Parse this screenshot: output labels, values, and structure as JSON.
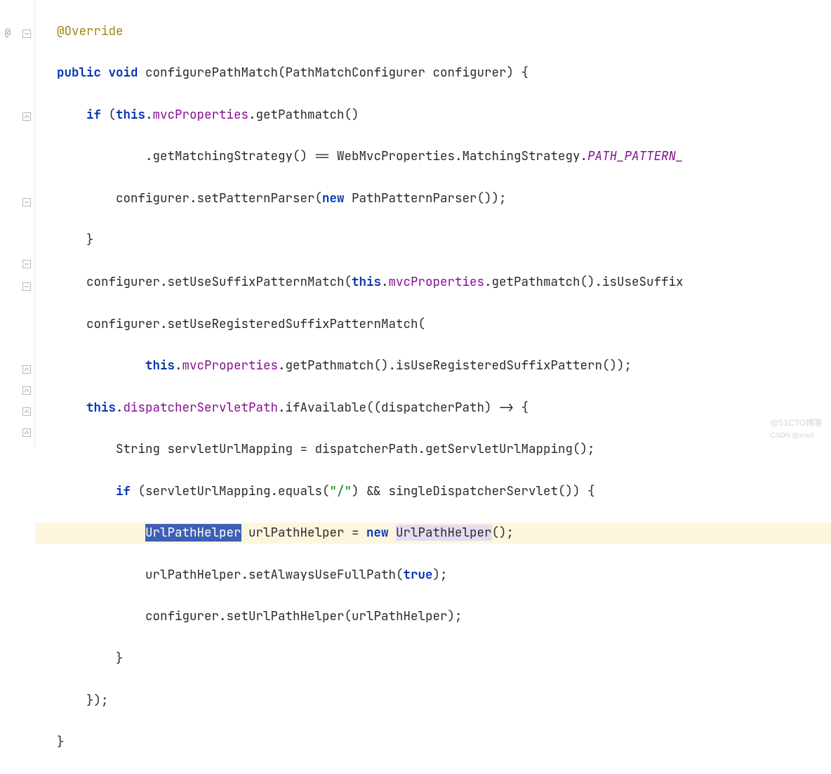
{
  "gutter": {
    "at_symbol": "@"
  },
  "watermark": {
    "text1": "@51CTO博客",
    "text2": "CSDN @zoeil"
  },
  "code": {
    "l1": {
      "ann": "@Override"
    },
    "l2": {
      "kw1": "public",
      "kw2": "void",
      "method": " configurePathMatch(PathMatchConfigurer configurer) {"
    },
    "l3": {
      "kw": "if",
      "t1": " (",
      "kw2": "this",
      "t2": ".",
      "f": "mvcProperties",
      "t3": ".getPathmatch()"
    },
    "l4": {
      "t1": ".getMatchingStrategy() == WebMvcProperties.MatchingStrategy.",
      "sf": "PATH_PATTERN_"
    },
    "l5": {
      "t1": "configurer.setPatternParser(",
      "kw": "new",
      "t2": " PathPatternParser());"
    },
    "l6": {
      "t": "}"
    },
    "l7": {
      "t1": "configurer.setUseSuffixPatternMatch(",
      "kw": "this",
      "t2": ".",
      "f": "mvcProperties",
      "t3": ".getPathmatch().isUseSuffix"
    },
    "l8": {
      "t": "configurer.setUseRegisteredSuffixPatternMatch("
    },
    "l9": {
      "kw": "this",
      "t1": ".",
      "f": "mvcProperties",
      "t2": ".getPathmatch().isUseRegisteredSuffixPattern());"
    },
    "l10": {
      "kw": "this",
      "t1": ".",
      "f": "dispatcherServletPath",
      "t2": ".ifAvailable((dispatcherPath) -> {"
    },
    "l11": {
      "t": "String servletUrlMapping = dispatcherPath.getServletUrlMapping();"
    },
    "l12": {
      "kw": "if",
      "t1": " (servletUrlMapping.equals(",
      "str": "\"/\"",
      "t2": ") && singleDispatcherServlet()) {"
    },
    "l13": {
      "sel": "UrlPathHelper",
      "t1": " urlPathHelper = ",
      "kw": "new",
      "t2": " ",
      "u": "UrlPathHelper",
      "t3": "();"
    },
    "l14": {
      "t1": "urlPathHelper.setAlwaysUseFullPath(",
      "kw": "true",
      "t2": ");"
    },
    "l15": {
      "t": "configurer.setUrlPathHelper(urlPathHelper);"
    },
    "l16": {
      "t": "}"
    },
    "l17": {
      "t": "});"
    },
    "l18": {
      "t": "}"
    }
  }
}
